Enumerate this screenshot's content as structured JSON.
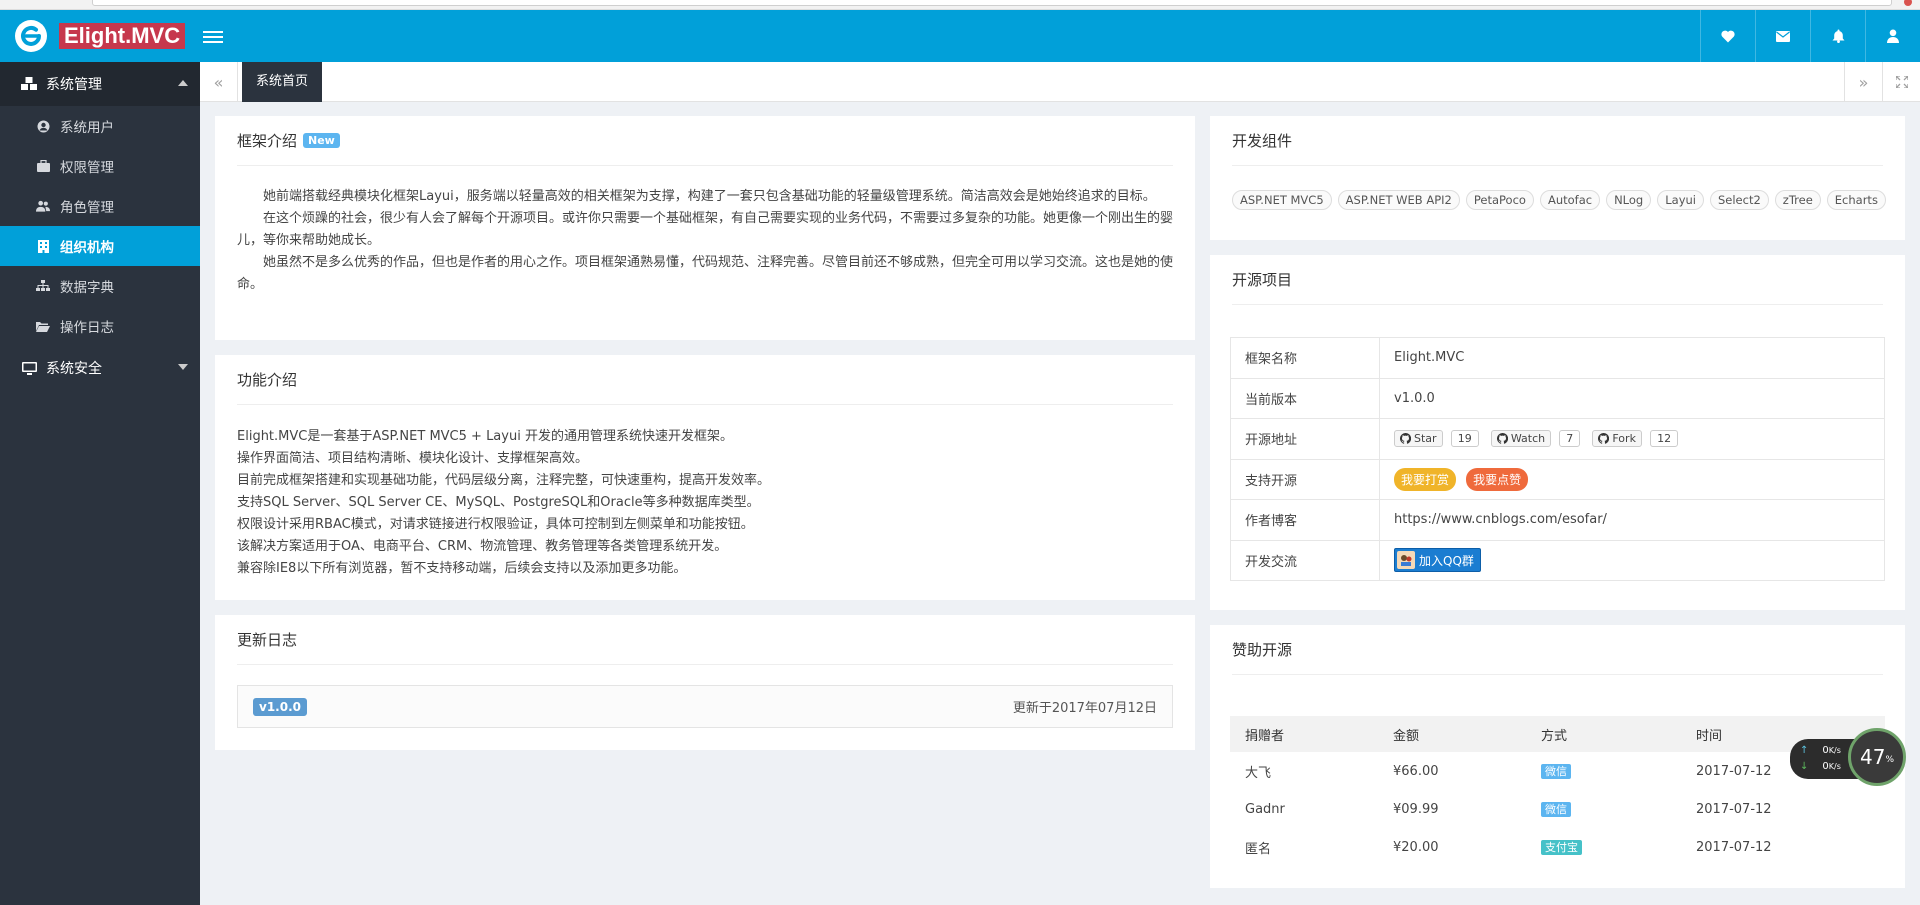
{
  "app": {
    "brand": "Elight.MVC"
  },
  "header_icons": [
    "heart-icon",
    "envelope-icon",
    "bell-icon",
    "user-icon"
  ],
  "sidebar": {
    "groups": [
      {
        "label": "系统管理",
        "icon": "cubes-icon",
        "expanded": true,
        "items": [
          {
            "label": "系统用户",
            "icon": "user-circle-icon"
          },
          {
            "label": "权限管理",
            "icon": "briefcase-icon"
          },
          {
            "label": "角色管理",
            "icon": "users-icon"
          },
          {
            "label": "组织机构",
            "icon": "building-icon",
            "active": true
          },
          {
            "label": "数据字典",
            "icon": "sitemap-icon"
          },
          {
            "label": "操作日志",
            "icon": "folder-open-icon"
          }
        ]
      },
      {
        "label": "系统安全",
        "icon": "desktop-icon",
        "expanded": false,
        "items": []
      }
    ]
  },
  "tabs": {
    "active": "系统首页"
  },
  "intro": {
    "title": "框架介绍",
    "badge": "New",
    "paragraphs": [
      "她前端搭载经典模块化框架Layui，服务端以轻量高效的相关框架为支撑，构建了一套只包含基础功能的轻量级管理系统。简洁高效会是她始终追求的目标。",
      "在这个烦躁的社会，很少有人会了解每个开源项目。或许你只需要一个基础框架，有自己需要实现的业务代码，不需要过多复杂的功能。她更像一个刚出生的婴儿，等你来帮助她成长。",
      "她虽然不是多么优秀的作品，但也是作者的用心之作。项目框架通熟易懂，代码规范、注释完善。尽管目前还不够成熟，但完全可用以学习交流。这也是她的使命。"
    ]
  },
  "features": {
    "title": "功能介绍",
    "lines": [
      "Elight.MVC是一套基于ASP.NET MVC5 + Layui 开发的通用管理系统快速开发框架。",
      "操作界面简洁、项目结构清晰、模块化设计、支撑框架高效。",
      "目前完成框架搭建和实现基础功能，代码层级分离，注释完整，可快速重构，提高开发效率。",
      "支持SQL Server、SQL Server CE、MySQL、PostgreSQL和Oracle等多种数据库类型。",
      "权限设计采用RBAC模式，对请求链接进行权限验证，具体可控制到左侧菜单和功能按钮。",
      "该解决方案适用于OA、电商平台、CRM、物流管理、教务管理等各类管理系统开发。",
      "兼容除IE8以下所有浏览器，暂不支持移动端，后续会支持以及添加更多功能。"
    ]
  },
  "changelog": {
    "title": "更新日志",
    "version": "v1.0.0",
    "date": "更新于2017年07月12日"
  },
  "components": {
    "title": "开发组件",
    "tags": [
      "ASP.NET MVC5",
      "ASP.NET WEB API2",
      "PetaPoco",
      "Autofac",
      "NLog",
      "Layui",
      "Select2",
      "zTree",
      "Echarts"
    ]
  },
  "project": {
    "title": "开源项目",
    "rows": {
      "name_key": "框架名称",
      "name_val": "Elight.MVC",
      "ver_key": "当前版本",
      "ver_val": "v1.0.0",
      "addr_key": "开源地址",
      "support_key": "支持开源",
      "blog_key": "作者博客",
      "blog_val": "https://www.cnblogs.com/esofar/",
      "comm_key": "开发交流"
    },
    "github": {
      "star": "Star",
      "star_count": "19",
      "watch": "Watch",
      "watch_count": "7",
      "fork": "Fork",
      "fork_count": "12"
    },
    "support_buttons": {
      "donate": "我要打赏",
      "like": "我要点赞"
    },
    "qq_button": "加入QQ群"
  },
  "donations": {
    "title": "赞助开源",
    "headers": [
      "捐赠者",
      "金额",
      "方式",
      "时间"
    ],
    "rows": [
      {
        "name": "大飞",
        "amount": "¥66.00",
        "method": "微信",
        "date": "2017-07-12"
      },
      {
        "name": "Gadnr",
        "amount": "¥09.99",
        "method": "微信",
        "date": "2017-07-12"
      },
      {
        "name": "匿名",
        "amount": "¥20.00",
        "method": "支付宝",
        "date": "2017-07-12"
      }
    ]
  },
  "speed_widget": {
    "up": "0",
    "down": "0",
    "unit": "K/s",
    "percent": "47",
    "percent_sign": "%"
  },
  "colors": {
    "header": "#01a0d9",
    "sidebar": "#2b333e",
    "brand_bg": "#c6384d",
    "wechat": "#5cb5f0",
    "alipay": "#45c1c8",
    "donate_btn": "#f0b429",
    "like_btn": "#ef6a3c"
  }
}
